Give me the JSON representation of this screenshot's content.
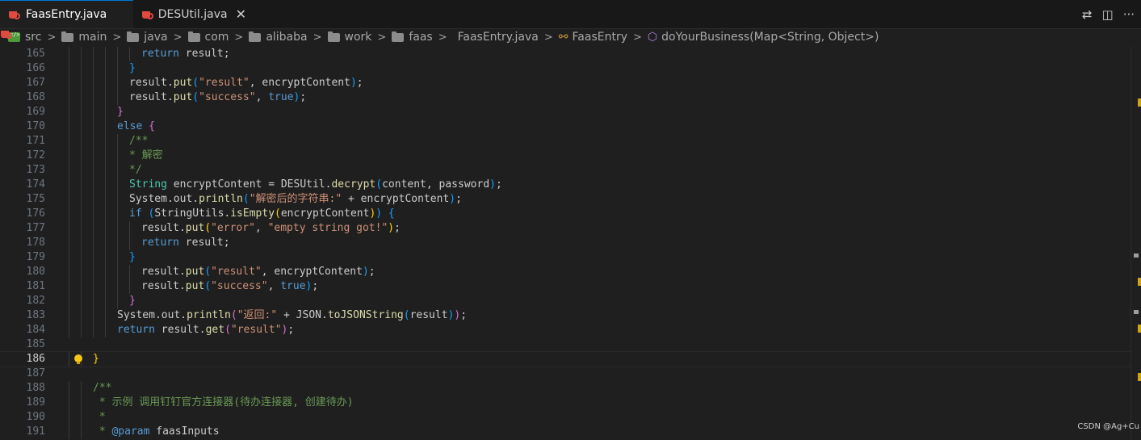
{
  "tabs": [
    {
      "label": "FaasEntry.java",
      "active": true
    },
    {
      "label": "DESUtil.java",
      "active": false,
      "close": "✕"
    }
  ],
  "tab_actions": [
    {
      "icon": "compare-changes-icon",
      "glyph": "⇄"
    },
    {
      "icon": "split-editor-icon",
      "glyph": "◫"
    },
    {
      "icon": "more-actions-icon",
      "glyph": "···"
    }
  ],
  "breadcrumb": {
    "items": [
      "src",
      "main",
      "java",
      "com",
      "alibaba",
      "work",
      "faas",
      "FaasEntry.java",
      "FaasEntry",
      "doYourBusiness(Map<String, Object>)"
    ]
  },
  "editor": {
    "current_line": "186",
    "lines": [
      {
        "n": "165",
        "indent": 6,
        "tokens": [
          [
            "kw",
            "return"
          ],
          [
            "pl",
            " result;"
          ]
        ]
      },
      {
        "n": "166",
        "indent": 5,
        "tokens": [
          [
            "br3",
            "}"
          ]
        ]
      },
      {
        "n": "167",
        "indent": 5,
        "tokens": [
          [
            "pl",
            "result."
          ],
          [
            "fn",
            "put"
          ],
          [
            "br3",
            "("
          ],
          [
            "str",
            "\"result\""
          ],
          [
            "pl",
            ", encryptContent"
          ],
          [
            "br3",
            ")"
          ],
          [
            "pl",
            ";"
          ]
        ]
      },
      {
        "n": "168",
        "indent": 5,
        "tokens": [
          [
            "pl",
            "result."
          ],
          [
            "fn",
            "put"
          ],
          [
            "br3",
            "("
          ],
          [
            "str",
            "\"success\""
          ],
          [
            "pl",
            ", "
          ],
          [
            "kw",
            "true"
          ],
          [
            "br3",
            ")"
          ],
          [
            "pl",
            ";"
          ]
        ]
      },
      {
        "n": "169",
        "indent": 4,
        "tokens": [
          [
            "br2",
            "}"
          ]
        ]
      },
      {
        "n": "170",
        "indent": 4,
        "tokens": [
          [
            "kw",
            "else"
          ],
          [
            "pl",
            " "
          ],
          [
            "br2",
            "{"
          ]
        ]
      },
      {
        "n": "171",
        "indent": 5,
        "tokens": [
          [
            "cm",
            "/**"
          ]
        ]
      },
      {
        "n": "172",
        "indent": 5,
        "tokens": [
          [
            "cm",
            "* 解密"
          ]
        ]
      },
      {
        "n": "173",
        "indent": 5,
        "tokens": [
          [
            "cm",
            "*/"
          ]
        ]
      },
      {
        "n": "174",
        "indent": 5,
        "tokens": [
          [
            "ty",
            "String"
          ],
          [
            "pl",
            " encryptContent = DESUtil."
          ],
          [
            "fn",
            "decrypt"
          ],
          [
            "br3",
            "("
          ],
          [
            "pl",
            "content, password"
          ],
          [
            "br3",
            ")"
          ],
          [
            "pl",
            ";"
          ]
        ]
      },
      {
        "n": "175",
        "indent": 5,
        "tokens": [
          [
            "pl",
            "System.out."
          ],
          [
            "fn",
            "println"
          ],
          [
            "br3",
            "("
          ],
          [
            "str",
            "\"解密后的字符串:\""
          ],
          [
            "pl",
            " + encryptContent"
          ],
          [
            "br3",
            ")"
          ],
          [
            "pl",
            ";"
          ]
        ]
      },
      {
        "n": "176",
        "indent": 5,
        "tokens": [
          [
            "kw",
            "if"
          ],
          [
            "pl",
            " "
          ],
          [
            "br3",
            "("
          ],
          [
            "pl",
            "StringUtils."
          ],
          [
            "fn",
            "isEmpty"
          ],
          [
            "br1",
            "("
          ],
          [
            "pl",
            "encryptContent"
          ],
          [
            "br1",
            ")"
          ],
          [
            "br3",
            ")"
          ],
          [
            "pl",
            " "
          ],
          [
            "br3",
            "{"
          ]
        ]
      },
      {
        "n": "177",
        "indent": 6,
        "tokens": [
          [
            "pl",
            "result."
          ],
          [
            "fn",
            "put"
          ],
          [
            "br1",
            "("
          ],
          [
            "str",
            "\"error\""
          ],
          [
            "pl",
            ", "
          ],
          [
            "str",
            "\"empty string got!\""
          ],
          [
            "br1",
            ")"
          ],
          [
            "pl",
            ";"
          ]
        ]
      },
      {
        "n": "178",
        "indent": 6,
        "tokens": [
          [
            "kw",
            "return"
          ],
          [
            "pl",
            " result;"
          ]
        ]
      },
      {
        "n": "179",
        "indent": 5,
        "tokens": [
          [
            "br3",
            "}"
          ]
        ]
      },
      {
        "n": "180",
        "indent": 6,
        "tokens": [
          [
            "pl",
            "result."
          ],
          [
            "fn",
            "put"
          ],
          [
            "br3",
            "("
          ],
          [
            "str",
            "\"result\""
          ],
          [
            "pl",
            ", encryptContent"
          ],
          [
            "br3",
            ")"
          ],
          [
            "pl",
            ";"
          ]
        ]
      },
      {
        "n": "181",
        "indent": 6,
        "tokens": [
          [
            "pl",
            "result."
          ],
          [
            "fn",
            "put"
          ],
          [
            "br3",
            "("
          ],
          [
            "str",
            "\"success\""
          ],
          [
            "pl",
            ", "
          ],
          [
            "kw",
            "true"
          ],
          [
            "br3",
            ")"
          ],
          [
            "pl",
            ";"
          ]
        ]
      },
      {
        "n": "182",
        "indent": 5,
        "tokens": [
          [
            "br2",
            "}"
          ]
        ]
      },
      {
        "n": "183",
        "indent": 4,
        "tokens": [
          [
            "pl",
            "System.out."
          ],
          [
            "fn",
            "println"
          ],
          [
            "br2",
            "("
          ],
          [
            "str",
            "\"返回:\""
          ],
          [
            "pl",
            " + JSON."
          ],
          [
            "fn",
            "toJSONString"
          ],
          [
            "br3",
            "("
          ],
          [
            "pl",
            "result"
          ],
          [
            "br3",
            ")"
          ],
          [
            "br2",
            ")"
          ],
          [
            "pl",
            ";"
          ]
        ]
      },
      {
        "n": "184",
        "indent": 4,
        "tokens": [
          [
            "kw",
            "return"
          ],
          [
            "pl",
            " result."
          ],
          [
            "fn",
            "get"
          ],
          [
            "br2",
            "("
          ],
          [
            "str",
            "\"result\""
          ],
          [
            "br2",
            ")"
          ],
          [
            "pl",
            ";"
          ]
        ]
      },
      {
        "n": "185",
        "indent": 0,
        "tokens": []
      },
      {
        "n": "186",
        "indent": 2,
        "tokens": [
          [
            "br1",
            "}"
          ]
        ]
      },
      {
        "n": "187",
        "indent": 0,
        "tokens": []
      },
      {
        "n": "188",
        "indent": 2,
        "tokens": [
          [
            "cm",
            "/**"
          ]
        ]
      },
      {
        "n": "189",
        "indent": 2,
        "tokens": [
          [
            "cm",
            " * 示例 调用钉钉官方连接器(待办连接器, 创建待办)"
          ]
        ]
      },
      {
        "n": "190",
        "indent": 2,
        "tokens": [
          [
            "cm",
            " *"
          ]
        ]
      },
      {
        "n": "191",
        "indent": 2,
        "tokens": [
          [
            "cm",
            " * "
          ],
          [
            "tag",
            "@param"
          ],
          [
            "pl",
            " faasInputs"
          ]
        ]
      }
    ]
  },
  "watermark": "CSDN @Ag+Cu"
}
